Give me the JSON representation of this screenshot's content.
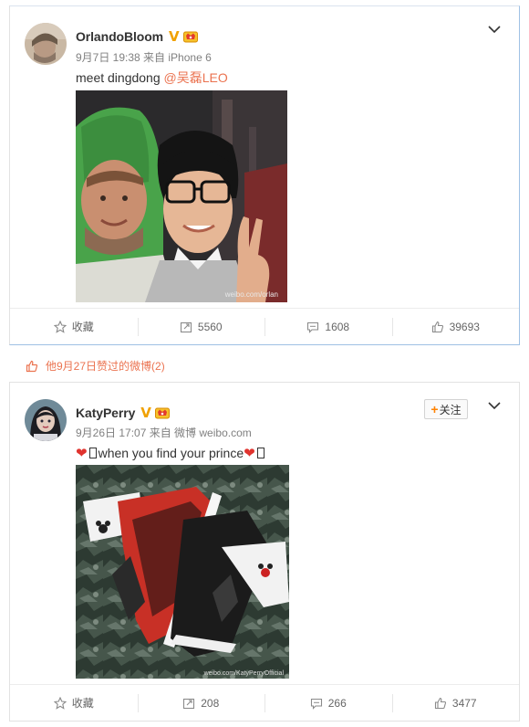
{
  "posts": [
    {
      "username": "OrlandoBloom",
      "verified_mark": "V",
      "meta": "9月7日 19:38 来自 iPhone 6",
      "text": "meet dingdong ",
      "mention": "@吴磊LEO",
      "watermark": "weibo.com/orlan",
      "actions": {
        "favorite": "收藏",
        "repost": "5560",
        "comment": "1608",
        "like": "39693"
      }
    },
    {
      "username": "KatyPerry",
      "verified_mark": "V",
      "follow_label": "关注",
      "follow_plus": "+",
      "meta": "9月26日 17:07 来自 微博 weibo.com",
      "heart": "❤",
      "text": "when you find your prince",
      "watermark": "weibo.com/KatyPerryOfficial",
      "actions": {
        "favorite": "收藏",
        "repost": "208",
        "comment": "266",
        "like": "3477"
      }
    }
  ],
  "liked_bar": {
    "text": "他9月27日赞过的微博(2)"
  },
  "icons": [
    "avatar",
    "verified-icon",
    "member-badge-icon",
    "chevron-down-icon",
    "star-icon",
    "repost-icon",
    "comment-icon",
    "thumbs-up-icon"
  ],
  "colors": {
    "accent_orange": "#eb7350",
    "verified_gold": "#f0a100",
    "heart_red": "#e0332e",
    "divider": "#e2e2e2"
  }
}
